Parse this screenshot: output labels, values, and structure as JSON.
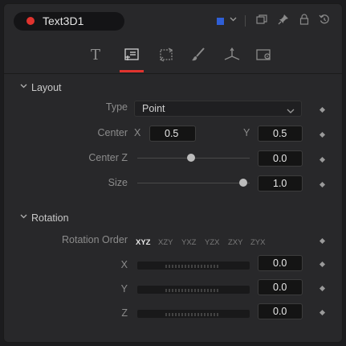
{
  "header": {
    "title": "Text3D1",
    "color_swatch": "#2f5fd6",
    "icons": [
      "chevron-down-icon",
      "window-icon",
      "pin-icon",
      "lock-icon",
      "reset-icon"
    ]
  },
  "tabs": [
    {
      "name": "text",
      "icon": "text-icon",
      "glyph": "T"
    },
    {
      "name": "layout",
      "icon": "layout-icon",
      "active": true
    },
    {
      "name": "transform",
      "icon": "transform-icon"
    },
    {
      "name": "shading",
      "icon": "brush-icon"
    },
    {
      "name": "3d",
      "icon": "axis-icon"
    },
    {
      "name": "settings",
      "icon": "settings-icon"
    }
  ],
  "layout_section": {
    "title": "Layout",
    "type_label": "Type",
    "type_value": "Point",
    "center_label": "Center",
    "center_x_label": "X",
    "center_x": "0.5",
    "center_y_label": "Y",
    "center_y": "0.5",
    "center_z_label": "Center Z",
    "center_z": "0.0",
    "center_z_level": 0.45,
    "size_label": "Size",
    "size": "1.0",
    "size_level": 0.95
  },
  "rotation_section": {
    "title": "Rotation",
    "order_label": "Rotation Order",
    "orders": [
      "XYZ",
      "XZY",
      "YXZ",
      "YZX",
      "ZXY",
      "ZYX"
    ],
    "selected_order": "XYZ",
    "x_label": "X",
    "x": "0.0",
    "y_label": "Y",
    "y": "0.0",
    "z_label": "Z",
    "z": "0.0"
  },
  "colors": {
    "accent": "#e0332e",
    "panel": "#28282a",
    "field": "#141414"
  }
}
